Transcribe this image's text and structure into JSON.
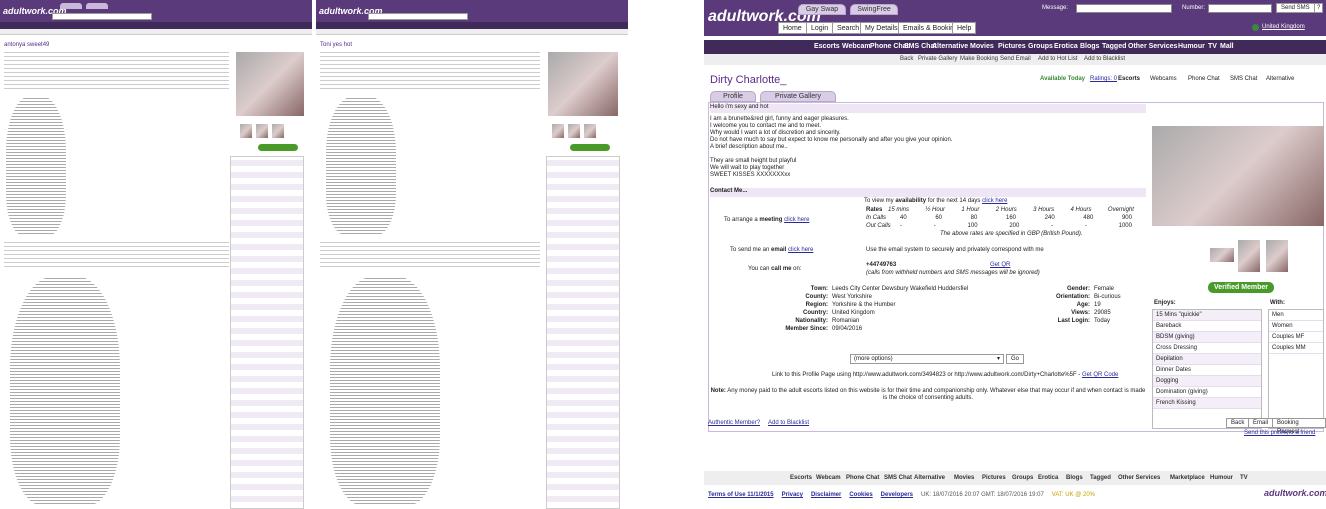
{
  "pane1": {
    "name": "antonya sweet49"
  },
  "pane2": {
    "name": "Toni yes hot"
  },
  "main": {
    "top_tabs": [
      "Gay Swap",
      "SwingFree"
    ],
    "search": {
      "message_label": "Message:",
      "number_label": "Number:",
      "send_button": "Send SMS",
      "help_button": "?"
    },
    "top_buttons": [
      "Home",
      "Login",
      "Search",
      "My Details",
      "Emails & Bookings",
      "Help"
    ],
    "region_link": "United Kingdom",
    "nav": [
      "Escorts",
      "Webcam",
      "Phone Chat",
      "SMS Chat",
      "Alternative",
      "Movies",
      "Pictures",
      "Groups",
      "Erotica",
      "Blogs",
      "Tagged",
      "Other Services",
      "Humour",
      "TV",
      "Mall"
    ],
    "subnav": [
      "Back",
      "Private Gallery",
      "Make Booking",
      "Send Email",
      "Add to Hot List",
      "Add to Blacklist"
    ],
    "profile_name": "Dirty Charlotte_",
    "availability": {
      "status": "Available Today",
      "ratings": "Ratings: 0",
      "services": [
        "Escorts",
        "Webcams",
        "Phone Chat",
        "SMS Chat",
        "Alternative"
      ]
    },
    "profile_tabs": [
      "Profile",
      "Private Gallery"
    ],
    "headline": "Hello i'm sexy and hot",
    "description": [
      "I am a brunette&red girl, funny and eager pleasures.",
      "I welcome you to contact me and to meet.",
      "Why would I want a lot of discretion and sincerity.",
      "Do not have much to say but expect to know me personally and after you give your opinion.",
      "A brief description about me..",
      "",
      "They are small height but playful",
      "We will wait to play together",
      "SWEET KISSES XXXXXXXxx"
    ],
    "contact": {
      "heading": "Contact Me...",
      "meeting_label": "To arrange a",
      "meeting_bold": "meeting",
      "meeting_link": "click here",
      "avail_prefix": "To view my",
      "avail_bold": "availability",
      "avail_suffix": "for the next 14 days",
      "avail_link": "click here",
      "rates_label": "Rates",
      "rates_cols": [
        "15 mins",
        "½ Hour",
        "1 Hour",
        "2 Hours",
        "3 Hours",
        "4 Hours",
        "Overnight"
      ],
      "in_calls_label": "In Calls",
      "in_calls": [
        "40",
        "60",
        "80",
        "160",
        "240",
        "480",
        "900"
      ],
      "out_calls_label": "Out Calls",
      "out_calls": [
        "-",
        "-",
        "100",
        "200",
        "-",
        "-",
        "1000"
      ],
      "rates_note": "The above rates are specified in GBP (British Pound).",
      "email_label": "To send me an",
      "email_bold": "email",
      "email_link": "click here",
      "email_note": "Use the email system to securely and privately correspond with me",
      "call_label": "You can",
      "call_bold": "call me",
      "call_suffix": "on:",
      "phone": "+44749763",
      "qr": "Get QR",
      "phone_note": "(calls from withheld numbers and SMS messages will be ignored)"
    },
    "details_left": [
      [
        "Town:",
        "Leeds City Center Dewsbury Wakefield Huddersfiel"
      ],
      [
        "County:",
        "West Yorkshire"
      ],
      [
        "Region:",
        "Yorkshire & the Humber"
      ],
      [
        "Country:",
        "United Kingdom"
      ],
      [
        "Nationality:",
        "Romanian"
      ],
      [
        "Member Since:",
        "09/04/2016"
      ]
    ],
    "details_right": [
      [
        "Gender:",
        "Female"
      ],
      [
        "Orientation:",
        "Bi-curious"
      ],
      [
        "Age:",
        "19"
      ],
      [
        "Views:",
        "29085"
      ],
      [
        "Last Login:",
        "Today"
      ]
    ],
    "options_select": "(more options)",
    "go_button": "Go",
    "link_text": "Link to this Profile Page using http://www.adultwork.com/3494823 or http://www.adultwork.com/Dirty+Charlotte%5F -",
    "qr_link": "Get QR Code",
    "note_label": "Note:",
    "note_text": "Any money paid to the adult escorts listed on this website is for their time and companionship only. Whatever else that may occur if and when contact is made is the choice of consenting adults.",
    "bottom_left": [
      "Authentic Member?",
      "Add to Blacklist"
    ],
    "bottom_buttons": [
      "Back",
      "Email",
      "Booking Request"
    ],
    "send_profile": "Send this profile to a friend",
    "verified": "Verified Member",
    "enjoys_label": "Enjoys:",
    "with_label": "With:",
    "enjoys": [
      "15 Mins \"quickie\"",
      "Bareback",
      "BDSM (giving)",
      "Cross Dressing",
      "Depilation",
      "Dinner Dates",
      "Dogging",
      "Domination (giving)",
      "French Kissing"
    ],
    "with": [
      "Men",
      "Women",
      "Couples MF",
      "Couples MM"
    ],
    "footer_nav": [
      "Escorts",
      "Webcam",
      "Phone Chat",
      "SMS Chat",
      "Alternative",
      "Movies",
      "Pictures",
      "Groups",
      "Erotica",
      "Blogs",
      "Tagged",
      "Other Services",
      "Marketplace",
      "Humour",
      "TV"
    ],
    "footer_links": [
      "Terms of Use 11/1/2015",
      "Privacy",
      "Disclaimer",
      "Cookies",
      "Developers"
    ],
    "footer_time": "UK: 18/07/2016 20:07  GMT: 18/07/2016 19:07",
    "footer_vat": "VAT: UK @ 20%",
    "logo": "adultwork.com"
  }
}
